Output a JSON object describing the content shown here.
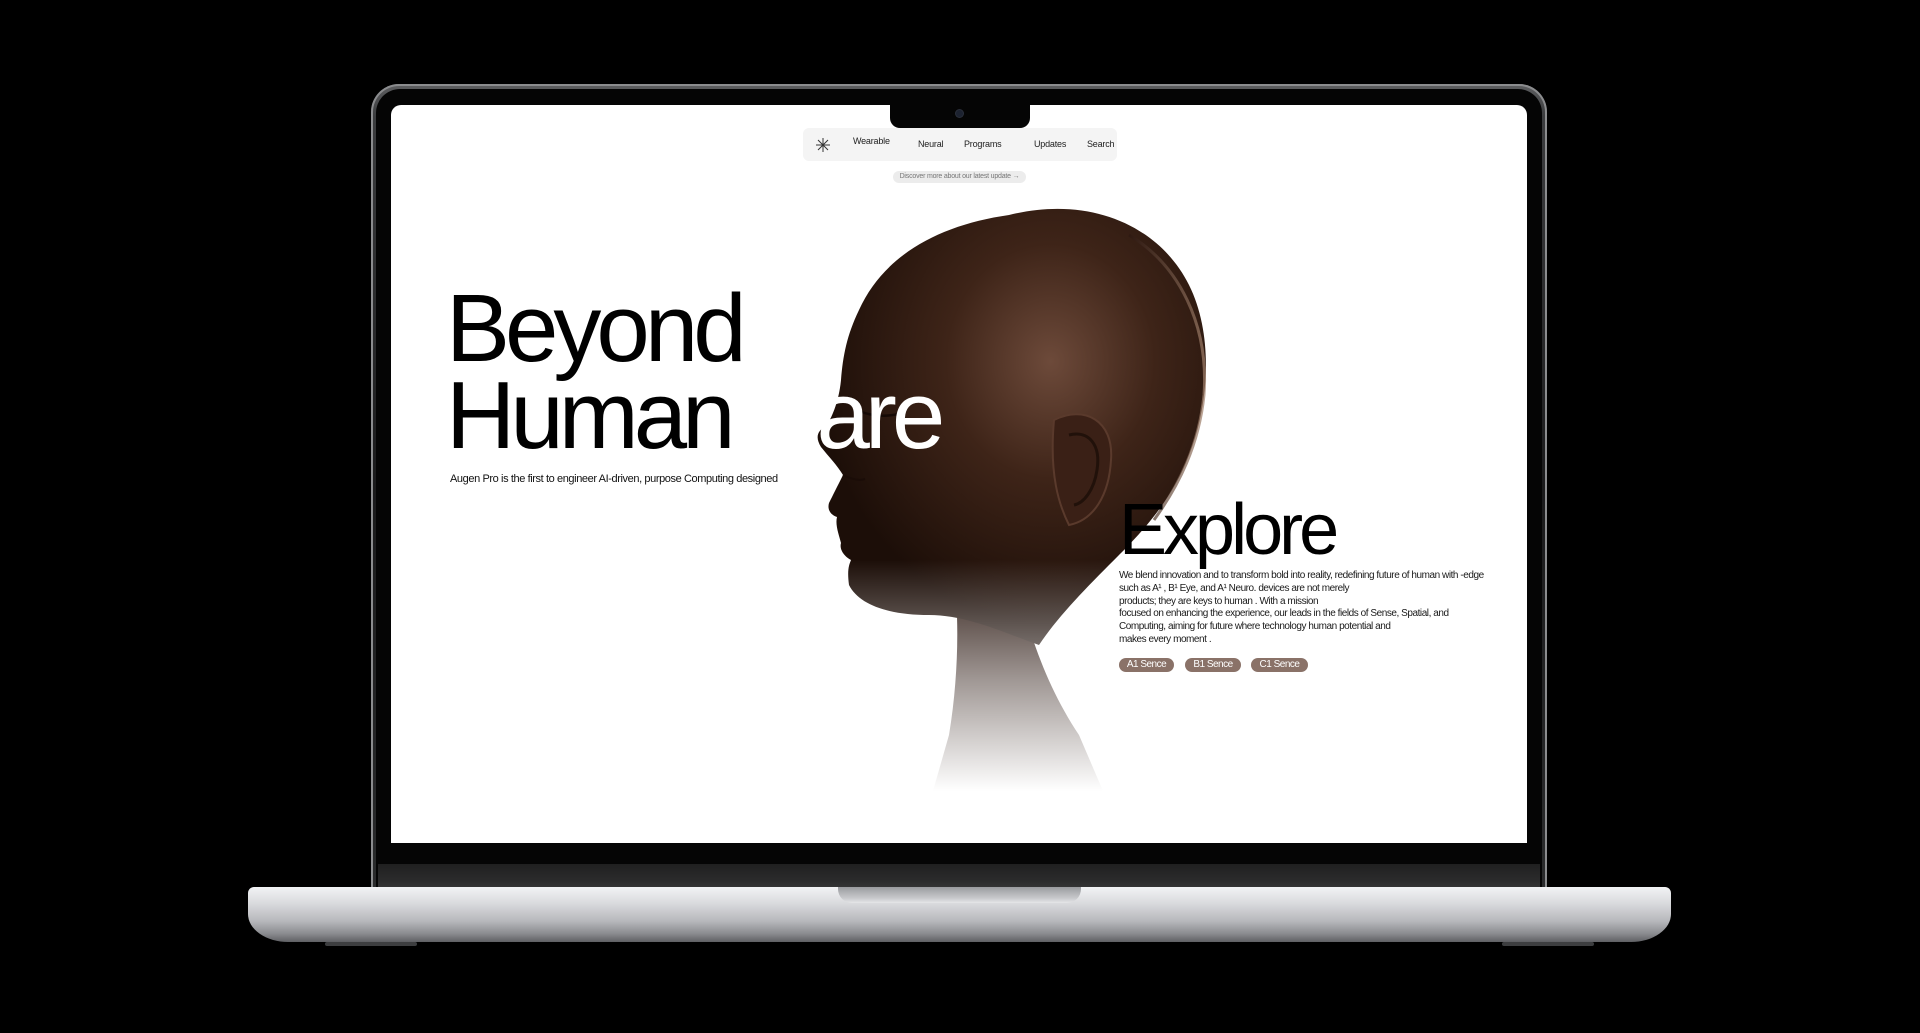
{
  "nav": {
    "items": [
      {
        "label": "Wearable"
      },
      {
        "label": "Neural"
      },
      {
        "label": "Programs"
      },
      {
        "label": "Updates"
      },
      {
        "label": "Search"
      }
    ]
  },
  "announcement": "Discover more about our latest update →",
  "hero": {
    "title_line1": "Beyond",
    "title_line2a": "Human",
    "title_line2b": "ware",
    "subtitle": "Augen Pro is the first to engineer AI-driven,  purpose Computing designed"
  },
  "explore": {
    "title": "Explore",
    "body_lines": [
      "We blend innovation and  to transform bold  into reality, redefining  future of human  with -edge",
      "such as A¹ , B¹ Eye, and A¹ Neuro.  devices are not merely",
      "products; they are keys to  human . With a mission",
      "focused on enhancing the  experience, our  leads in the fields of  Sense, Spatial, and",
      "Computing, aiming for  future where technology  human potential and",
      "makes every moment ."
    ],
    "tags": [
      "A1 Sence",
      "B1 Sence",
      "C1 Sence"
    ]
  },
  "colors": {
    "tag_background": "#8a7268",
    "page_background": "#ffffff",
    "device_background": "#000000"
  }
}
